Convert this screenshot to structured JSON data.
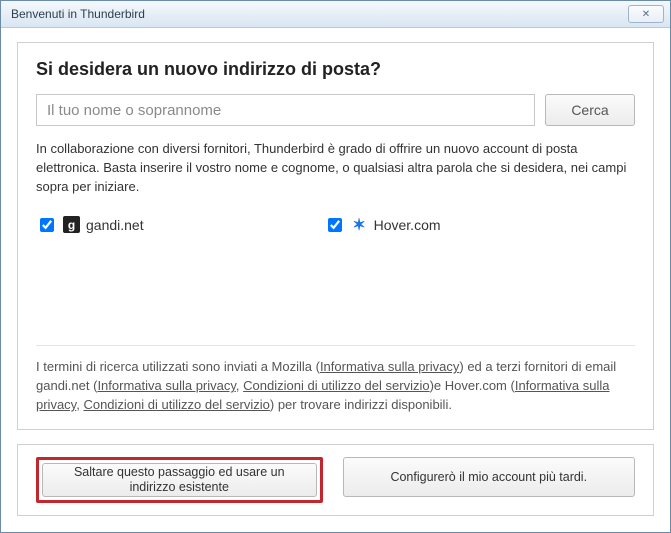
{
  "window": {
    "title": "Benvenuti in Thunderbird"
  },
  "main": {
    "heading": "Si desidera un nuovo indirizzo di posta?",
    "search_placeholder": "Il tuo nome o soprannome",
    "search_button": "Cerca",
    "intro": "In collaborazione con diversi fornitori, Thunderbird è grado di offrire un nuovo account di posta elettronica. Basta inserire il vostro nome e cognome, o qualsiasi altra parola che si desidera, nei campi sopra per iniziare.",
    "providers": [
      {
        "name": "gandi.net",
        "checked": true
      },
      {
        "name": "Hover.com",
        "checked": true
      }
    ],
    "legal": {
      "t1": "I termini di ricerca utilizzati sono inviati a Mozilla (",
      "l1": "Informativa sulla privacy",
      "t2": ") ed a terzi fornitori di email gandi.net (",
      "l2": "Informativa sulla privacy",
      "t3": ", ",
      "l3": "Condizioni di utilizzo del servizio",
      "t4": ")e Hover.com (",
      "l4": "Informativa sulla privacy",
      "t5": ", ",
      "l5": "Condizioni di utilizzo del servizio",
      "t6": ") per trovare indirizzi disponibili."
    }
  },
  "actions": {
    "skip": "Saltare questo passaggio ed usare un indirizzo esistente",
    "later": "Configurerò il mio account più tardi."
  }
}
